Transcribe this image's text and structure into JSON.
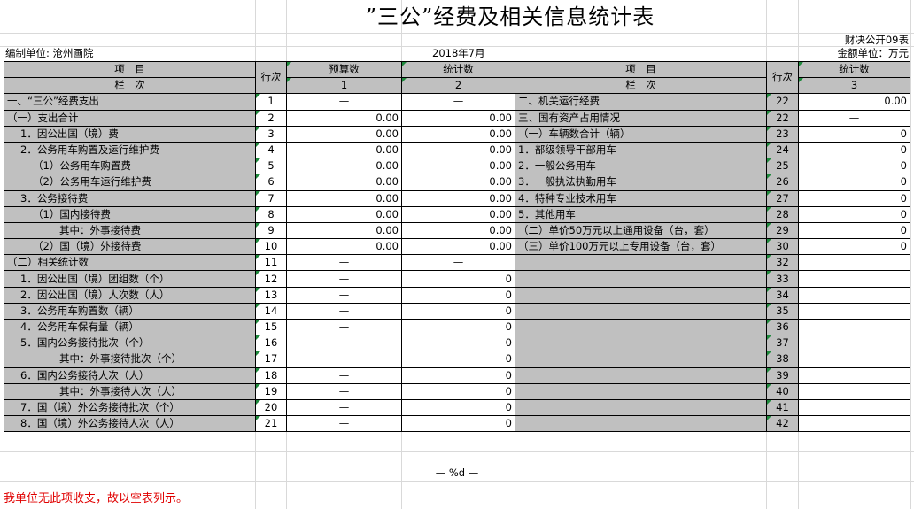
{
  "title": "”三公”经费及相关信息统计表",
  "form_code": "财决公开09表",
  "unit_label": "编制单位: 沧州画院",
  "period": "2018年7月",
  "money_unit": "金额单位：万元",
  "header": {
    "item_a": "项　目",
    "item_b": "栏　次",
    "row_no": "行次",
    "budget": "预算数",
    "budget_idx": "1",
    "stat": "统计数",
    "stat_idx": "2",
    "item2_a": "项　目",
    "item2_b": "栏　次",
    "row_no2": "行次",
    "stat2": "统计数",
    "stat2_idx": "3"
  },
  "rows": [
    {
      "l": "一、“三公”经费支出",
      "li": 0,
      "ln": "1",
      "b": "—",
      "s": "—",
      "r": "二、机关运行经费",
      "rn": "22",
      "v": "0.00"
    },
    {
      "l": "（一）支出合计",
      "li": 0,
      "ln": "2",
      "b": "0.00",
      "s": "0.00",
      "r": "三、国有资产占用情况",
      "rn": "22",
      "v": "—"
    },
    {
      "l": "1．因公出国（境）费",
      "li": 1,
      "ln": "3",
      "b": "0.00",
      "s": "0.00",
      "r": "（一）车辆数合计（辆）",
      "rn": "23",
      "v": "0"
    },
    {
      "l": "2．公务用车购置及运行维护费",
      "li": 1,
      "ln": "4",
      "b": "0.00",
      "s": "0.00",
      "r": "1．部级领导干部用车",
      "rn": "24",
      "v": "0"
    },
    {
      "l": "（1）公务用车购置费",
      "li": 2,
      "ln": "5",
      "b": "0.00",
      "s": "0.00",
      "r": "2．一般公务用车",
      "rn": "25",
      "v": "0"
    },
    {
      "l": "（2）公务用车运行维护费",
      "li": 2,
      "ln": "6",
      "b": "0.00",
      "s": "0.00",
      "r": "3．一般执法执勤用车",
      "rn": "26",
      "v": "0"
    },
    {
      "l": "3．公务接待费",
      "li": 1,
      "ln": "7",
      "b": "0.00",
      "s": "0.00",
      "r": "4．特种专业技术用车",
      "rn": "27",
      "v": "0"
    },
    {
      "l": "（1）国内接待费",
      "li": 2,
      "ln": "8",
      "b": "0.00",
      "s": "0.00",
      "r": "5．其他用车",
      "rn": "28",
      "v": "0"
    },
    {
      "l": "其中：外事接待费",
      "li": 3,
      "ln": "9",
      "b": "0.00",
      "s": "0.00",
      "r": "（二）单价50万元以上通用设备（台，套）",
      "rn": "29",
      "v": "0"
    },
    {
      "l": "（2）国（境）外接待费",
      "li": 2,
      "ln": "10",
      "b": "0.00",
      "s": "0.00",
      "r": "（三）单价100万元以上专用设备（台，套）",
      "rn": "30",
      "v": "0"
    },
    {
      "l": "（二）相关统计数",
      "li": 0,
      "ln": "11",
      "b": "—",
      "s": "—",
      "r": "",
      "rn": "32",
      "v": ""
    },
    {
      "l": "1．因公出国（境）团组数（个）",
      "li": 1,
      "ln": "12",
      "b": "—",
      "s": "0",
      "r": "",
      "rn": "33",
      "v": ""
    },
    {
      "l": "2．因公出国（境）人次数（人）",
      "li": 1,
      "ln": "13",
      "b": "—",
      "s": "0",
      "r": "",
      "rn": "34",
      "v": ""
    },
    {
      "l": "3．公务用车购置数（辆）",
      "li": 1,
      "ln": "14",
      "b": "—",
      "s": "0",
      "r": "",
      "rn": "35",
      "v": ""
    },
    {
      "l": "4．公务用车保有量（辆）",
      "li": 1,
      "ln": "15",
      "b": "—",
      "s": "0",
      "r": "",
      "rn": "36",
      "v": ""
    },
    {
      "l": "5．国内公务接待批次（个）",
      "li": 1,
      "ln": "16",
      "b": "—",
      "s": "0",
      "r": "",
      "rn": "37",
      "v": ""
    },
    {
      "l": "其中：外事接待批次（个）",
      "li": 3,
      "ln": "17",
      "b": "—",
      "s": "0",
      "r": "",
      "rn": "38",
      "v": ""
    },
    {
      "l": "6．国内公务接待人次（人）",
      "li": 1,
      "ln": "18",
      "b": "—",
      "s": "0",
      "r": "",
      "rn": "39",
      "v": ""
    },
    {
      "l": "其中：外事接待人次（人）",
      "li": 3,
      "ln": "19",
      "b": "—",
      "s": "0",
      "r": "",
      "rn": "40",
      "v": ""
    },
    {
      "l": "7．国（境）外公务接待批次（个）",
      "li": 1,
      "ln": "20",
      "b": "—",
      "s": "0",
      "r": "",
      "rn": "41",
      "v": ""
    },
    {
      "l": "8．国（境）外公务接待人次（人）",
      "li": 1,
      "ln": "21",
      "b": "—",
      "s": "0",
      "r": "",
      "rn": "42",
      "v": ""
    }
  ],
  "page_footer": "— %d —",
  "note": "我单位无此项收支，故以空表列示。",
  "colors": {
    "header_gray": "#c0c0c0",
    "note_red": "#e00000",
    "corner_mark": "#1f8a3d"
  }
}
